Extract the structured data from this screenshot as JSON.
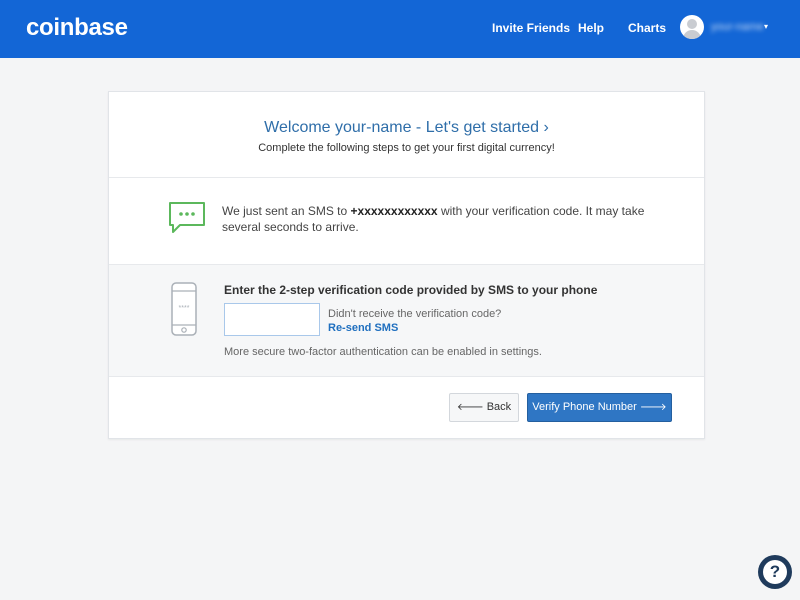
{
  "header": {
    "logo": "coinbase",
    "nav": {
      "invite": "Invite Friends",
      "help": "Help",
      "charts": "Charts"
    },
    "user": {
      "name": "your-name",
      "caret": "▾"
    }
  },
  "card": {
    "title": "Welcome your-name - Let's get started ›",
    "subtitle": "Complete the following steps to get your first digital currency!",
    "sms": {
      "prefix": "We just sent an SMS to ",
      "phone": "+xxxxxxxxxxxx",
      "suffix": " with your verification code. It may take several seconds to arrive.",
      "icon": "sms-chat-icon"
    },
    "code": {
      "label": "Enter the 2-step verification code provided by SMS to your phone",
      "input_value": "",
      "didnt_receive": "Didn't receive the verification code?",
      "resend": "Re-send SMS",
      "note": "More secure two-factor authentication can be enabled in settings.",
      "icon": "phone-icon"
    },
    "buttons": {
      "back": "Back",
      "back_arrow": "🡐",
      "verify": "Verify Phone Number",
      "verify_arrow": "🡒"
    }
  },
  "help_widget": {
    "glyph": "?"
  },
  "colors": {
    "brand": "#1366d6",
    "accent_green": "#5cb85c",
    "primary_button": "#2f76c4",
    "title_blue": "#2f6ea9"
  }
}
